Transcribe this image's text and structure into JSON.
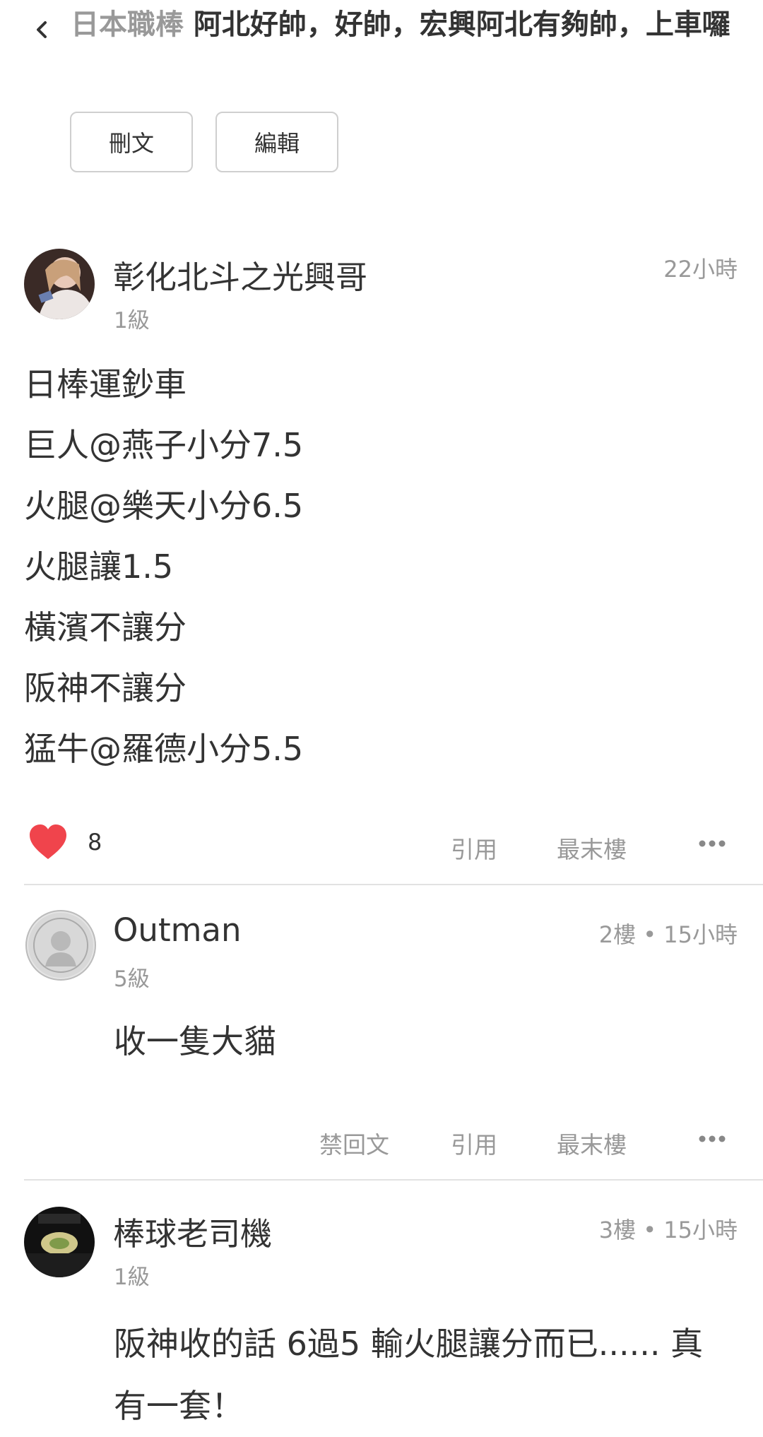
{
  "header": {
    "board": "日本職棒",
    "title": " 阿北好帥，好帥，宏興阿北有夠帥，上車囉",
    "delete_label": "刪文",
    "edit_label": "編輯"
  },
  "main_post": {
    "author": "彰化北斗之光興哥",
    "level": "1級",
    "time": "22小時",
    "lines": [
      "日棒運鈔車",
      "巨人@燕子小分7.5",
      "火腿@樂天小分6.5",
      "火腿讓1.5",
      "橫濱不讓分",
      "阪神不讓分",
      "猛牛@羅德小分5.5"
    ],
    "likes": "8",
    "quote_label": "引用",
    "last_floor_label": "最末樓",
    "like_color": "#f0444c"
  },
  "reply1": {
    "author": "Outman",
    "level": "5級",
    "meta": "2樓 • 15小時",
    "text": "收一隻大貓",
    "block_label": "禁回文",
    "quote_label": "引用",
    "last_floor_label": "最末樓"
  },
  "reply2": {
    "author": "棒球老司機",
    "level": "1級",
    "meta": "3樓 • 15小時",
    "text": "阪神收的話 6過5 輸火腿讓分而已...... 真有一套！"
  }
}
